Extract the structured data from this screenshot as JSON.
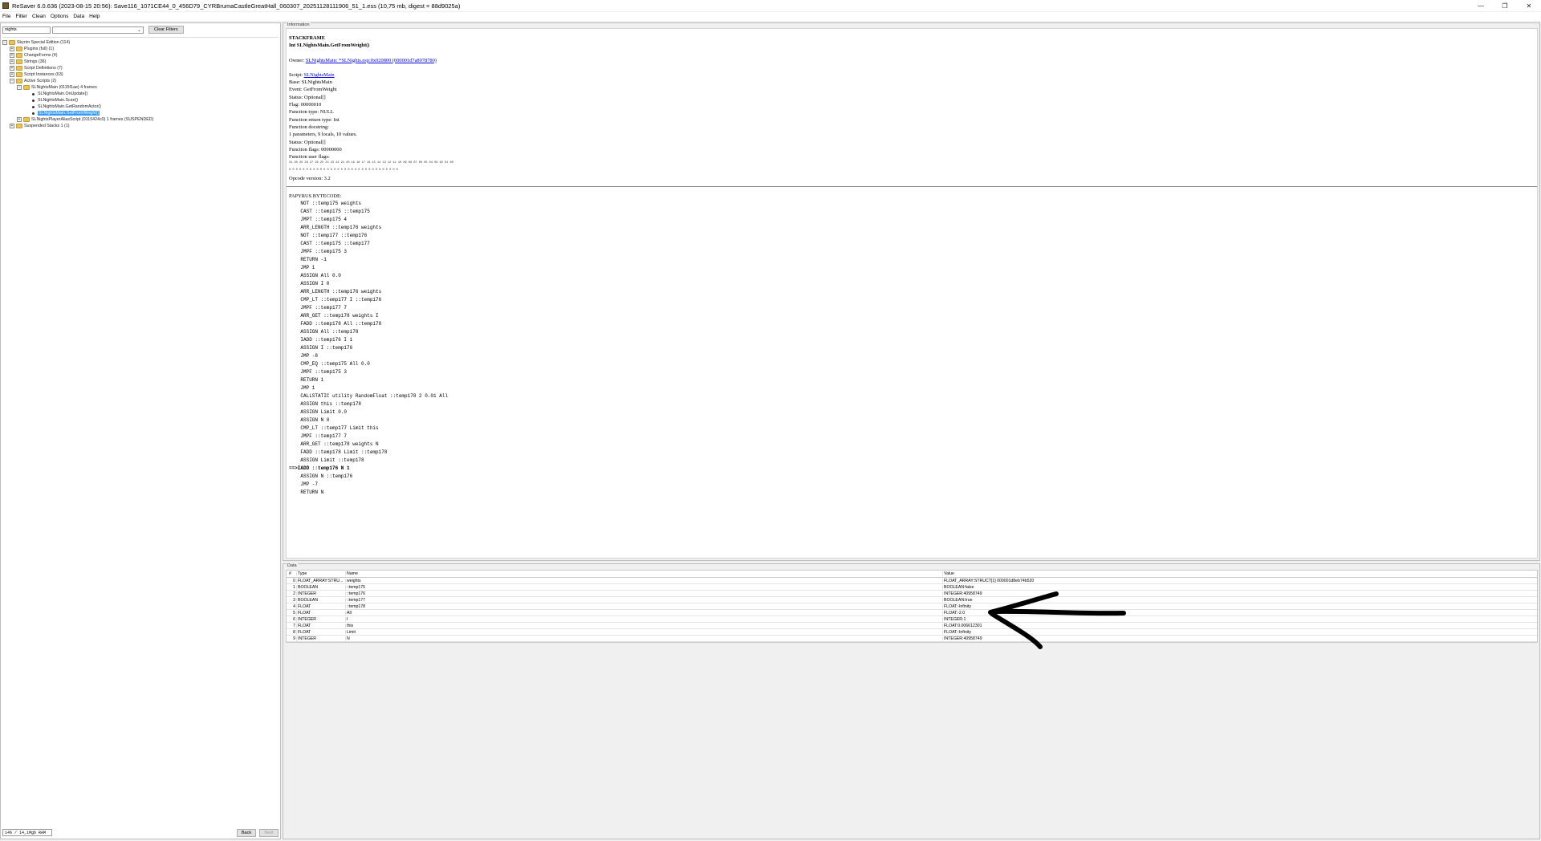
{
  "window": {
    "title": "ReSaver 6.0.636 (2023-08-15 20:56): Save116_1071CE44_0_456D79_CYRBrumaCastleGreatHall_060307_20251128111906_51_1.ess (10,75 mb, digest = 88d9025a)",
    "minimize": "—",
    "maximize": "❐",
    "close": "✕"
  },
  "menu": [
    "File",
    "Filter",
    "Clean",
    "Options",
    "Data",
    "Help"
  ],
  "filter": {
    "text": "nights",
    "combo_value": "",
    "clear_label": "Clear Filters"
  },
  "tree": [
    {
      "indent": 0,
      "exp": "−",
      "icon": "folder",
      "label": "Skyrim Special Edition (114)"
    },
    {
      "indent": 1,
      "exp": "+",
      "icon": "folder",
      "label": "Plugins (full) (1)"
    },
    {
      "indent": 1,
      "exp": "+",
      "icon": "folder",
      "label": "ChangeForms (4)"
    },
    {
      "indent": 1,
      "exp": "+",
      "icon": "folder",
      "label": "Strings (36)"
    },
    {
      "indent": 1,
      "exp": "+",
      "icon": "folder",
      "label": "Script Definitions (7)"
    },
    {
      "indent": 1,
      "exp": "+",
      "icon": "folder",
      "label": "Script Instances (63)"
    },
    {
      "indent": 1,
      "exp": "−",
      "icon": "folder",
      "label": "Active Scripts (2)"
    },
    {
      "indent": 2,
      "exp": "−",
      "icon": "folder",
      "label": "SLNightsMain (0115f1ae) 4 frames"
    },
    {
      "indent": 3,
      "exp": "",
      "icon": "dot",
      "label": "SLNightsMain.OnUpdate()"
    },
    {
      "indent": 3,
      "exp": "",
      "icon": "dot",
      "label": "SLNightsMain.Scan()"
    },
    {
      "indent": 3,
      "exp": "",
      "icon": "dot",
      "label": "SLNightsMain.GetRandomActor()"
    },
    {
      "indent": 3,
      "exp": "",
      "icon": "dot",
      "label": "SLNightsMain.GetFromWeight()",
      "selected": true
    },
    {
      "indent": 2,
      "exp": "+",
      "icon": "folder",
      "label": "SLNightsPlayerAliasScript (0115424c0) 1 frames (SUSPENDED)"
    },
    {
      "indent": 1,
      "exp": "+",
      "icon": "folder",
      "label": "Suspended Stacks 1 (1)"
    }
  ],
  "status": {
    "memory": "14% / 14,1Mgb RAM",
    "back": "Back",
    "next": "Next"
  },
  "info": {
    "legend": "Information",
    "heading": "STACKFRAME",
    "signature": "Int SLNightsMain.GetFromWeight()",
    "owner_label": "Owner: ",
    "owner_link": "SLNightsMain: *SLNights.esp:0x020800 (000001d7a8978780)",
    "script_label": "Script: ",
    "script_link": "SLNightsMain",
    "lines_a": [
      "Base: SLNightsMain",
      "Event: GetFromWeight",
      "Status: Optional[]",
      "Flag: 00000010",
      "Function type: NULL",
      "Function return type: Int",
      "Function docstring:",
      "1 parameters, 9 locals, 10 values.",
      "Status: Optional[]",
      "Function flags: 00000000",
      "Function user flags:"
    ],
    "bits_top": "31 30 29 28 27 26 25 24 23 22 21 20 19 18 17 16 15 14 13 12 11 10 09 08 07 06 05 04 03 02 01 00",
    "bits_bottom": "0  0  0  0  0  0  0  0  0  0  0  0  0  0  0  0  0  0  0  0  0  0  0  0  0  0  0  0  0  0  0  0",
    "opcode": "Opcode version: 3.2",
    "bytecode_heading": "PAPYRUS BYTECODE:",
    "bytecode": [
      "    NOT ::temp175 weights",
      "    CAST ::temp175 ::temp175",
      "    JMPT ::temp175 4",
      "    ARR_LENGTH ::temp176 weights",
      "    NOT ::temp177 ::temp176",
      "    CAST ::temp175 ::temp177",
      "    JMPF ::temp175 3",
      "    RETURN -1",
      "    JMP 1",
      "    ASSIGN All 0.0",
      "    ASSIGN I 0",
      "    ARR_LENGTH ::temp176 weights",
      "    CMP_LT ::temp177 I ::temp176",
      "    JMPF ::temp177 7",
      "    ARR_GET ::temp178 weights I",
      "    FADD ::temp178 All ::temp178",
      "    ASSIGN All ::temp178",
      "    IADD ::temp176 I 1",
      "    ASSIGN I ::temp176",
      "    JMP -8",
      "    CMP_EQ ::temp175 All 0.0",
      "    JMPF ::temp175 3",
      "    RETURN 1",
      "    JMP 1",
      "    CALLSTATIC utility RandomFloat ::temp178 2 0.01 All",
      "    ASSIGN this ::temp178",
      "    ASSIGN Limit 0.0",
      "    ASSIGN N 0",
      "    CMP_LT ::temp177 Limit this",
      "    JMPF ::temp177 7",
      "    ARR_GET ::temp178 weights N",
      "    FADD ::temp178 Limit ::temp178",
      "    ASSIGN Limit ::temp178",
      "==>IADD ::temp176 N 1",
      "    ASSIGN N ::temp176",
      "    JMP -7",
      "    RETURN N"
    ],
    "current_line_index": 33
  },
  "data": {
    "legend": "Data",
    "headers": {
      "idx": "#",
      "type": "Type",
      "name": "Name",
      "value": "Value"
    },
    "rows": [
      {
        "idx": "0",
        "type": "FLOAT_ARRAY:STRU...",
        "name": "weights",
        "value": "FLOAT_ARRAY:STRUCT[1] 000001d8eb74b520"
      },
      {
        "idx": "1",
        "type": "BOOLEAN",
        "name": "::temp175",
        "value": "BOOLEAN:false"
      },
      {
        "idx": "2",
        "type": "INTEGER",
        "name": "::temp176",
        "value": "INTEGER:40958749"
      },
      {
        "idx": "3",
        "type": "BOOLEAN",
        "name": "::temp177",
        "value": "BOOLEAN:true"
      },
      {
        "idx": "4",
        "type": "FLOAT",
        "name": "::temp178",
        "value": "FLOAT:-Infinity"
      },
      {
        "idx": "5",
        "type": "FLOAT",
        "name": "All",
        "value": "FLOAT:-2.0"
      },
      {
        "idx": "6",
        "type": "INTEGER",
        "name": "I",
        "value": "INTEGER:1"
      },
      {
        "idx": "7",
        "type": "FLOAT",
        "name": "this",
        "value": "FLOAT:0.006612301"
      },
      {
        "idx": "8",
        "type": "FLOAT",
        "name": "Limit",
        "value": "FLOAT:-Infinity"
      },
      {
        "idx": "9",
        "type": "INTEGER",
        "name": "N",
        "value": "INTEGER:40958749"
      }
    ]
  },
  "annotation": {
    "icon": "hand-drawn-arrow-icon",
    "color": "#000000"
  }
}
